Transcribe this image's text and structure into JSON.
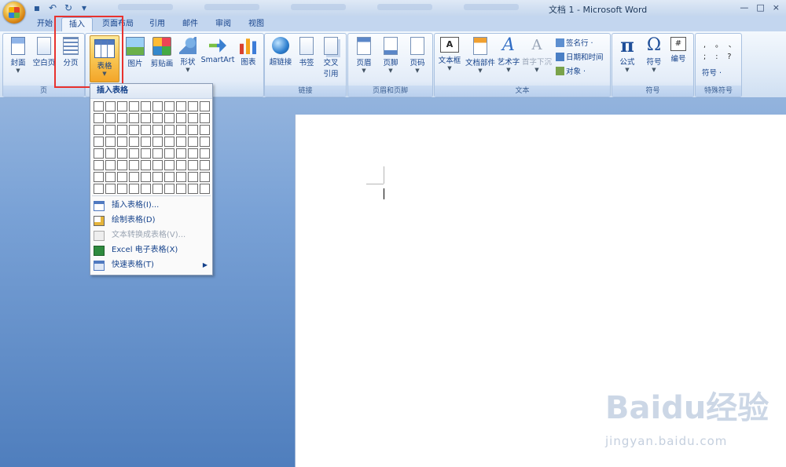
{
  "window": {
    "title": "文档 1 - Microsoft Word",
    "controls": [
      "—",
      "□",
      "×"
    ]
  },
  "tabs": [
    {
      "label": "开始",
      "active": false
    },
    {
      "label": "插入",
      "active": true
    },
    {
      "label": "页面布局",
      "active": false
    },
    {
      "label": "引用",
      "active": false
    },
    {
      "label": "邮件",
      "active": false
    },
    {
      "label": "审阅",
      "active": false
    },
    {
      "label": "视图",
      "active": false
    }
  ],
  "ribbon": {
    "pages": {
      "label": "页",
      "cover": "封面",
      "blank": "空白页",
      "break": "分页"
    },
    "tables": {
      "table": "表格"
    },
    "illustrations": {
      "picture": "图片",
      "clipart": "剪贴画",
      "shapes": "形状",
      "smartart": "SmartArt",
      "chart": "图表"
    },
    "links": {
      "label": "链接",
      "hyperlink": "超链接",
      "bookmark": "书签",
      "crossref_1": "交叉",
      "crossref_2": "引用"
    },
    "headerfooter": {
      "label": "页眉和页脚",
      "header": "页眉",
      "footer": "页脚",
      "pagenum": "页码"
    },
    "text": {
      "label": "文本",
      "textbox": "文本框",
      "quickparts": "文档部件",
      "wordart": "艺术字",
      "dropcap": "首字下沉",
      "signature": "签名行 ·",
      "datetime": "日期和时间",
      "object": "对象 ·"
    },
    "symbols": {
      "label": "符号",
      "equation": "公式",
      "symbol": "符号",
      "number": "编号"
    },
    "special": {
      "label": "特殊符号",
      "symbol": "符号 ·",
      "marks": [
        ",",
        "。",
        "、",
        ";",
        ":",
        "?"
      ]
    }
  },
  "menu": {
    "header": "插入表格",
    "grid_rows": 8,
    "grid_cols": 10,
    "items": [
      {
        "label": "插入表格(I)...",
        "enabled": true
      },
      {
        "label": "绘制表格(D)",
        "enabled": true
      },
      {
        "label": "文本转换成表格(V)...",
        "enabled": false
      },
      {
        "label": "Excel 电子表格(X)",
        "enabled": true
      },
      {
        "label": "快速表格(T)",
        "enabled": true,
        "submenu": true
      }
    ]
  },
  "watermark": {
    "brand": "Baidu经验",
    "url": "jingyan.baidu.com"
  }
}
